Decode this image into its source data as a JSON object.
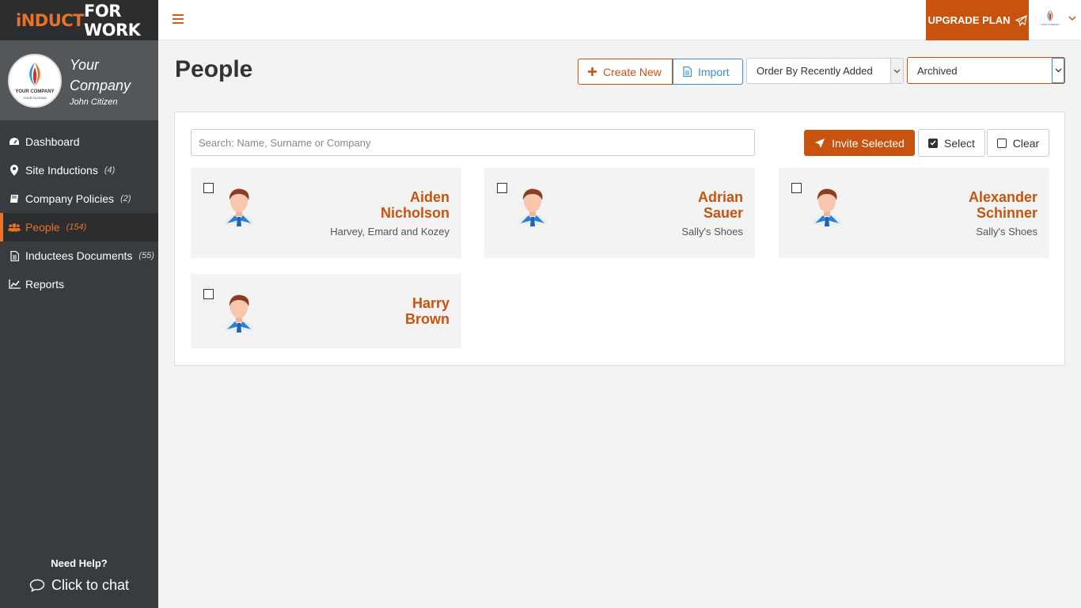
{
  "brand": {
    "part1": "iNDUCT",
    "part2": "FOR WORK"
  },
  "company": {
    "name_line1": "Your",
    "name_line2": "Company",
    "user": "John Citizen",
    "logo_text": "YOUR COMPANY",
    "logo_sub": "YOUR SLOGAN"
  },
  "nav": [
    {
      "label": "Dashboard",
      "count": "",
      "icon": "dashboard-icon"
    },
    {
      "label": "Site Inductions",
      "count": "(4)",
      "icon": "map-marker-icon"
    },
    {
      "label": "Company Policies",
      "count": "(2)",
      "icon": "book-icon"
    },
    {
      "label": "People",
      "count": "(154)",
      "icon": "users-icon"
    },
    {
      "label": "Inductees Documents",
      "count": "(55)",
      "icon": "document-icon"
    },
    {
      "label": "Reports",
      "count": "",
      "icon": "line-chart-icon"
    }
  ],
  "help": {
    "title": "Need Help?",
    "chat": "Click to chat"
  },
  "topbar": {
    "upgrade": "UPGRADE PLAN",
    "avatar_text": "YOUR COMPANY"
  },
  "header": {
    "title": "People",
    "create_new": "Create New",
    "import": "Import",
    "order_by": "Order By Recently Added",
    "filter": "Archived"
  },
  "toolbar": {
    "search_placeholder": "Search: Name, Surname or Company",
    "invite": "Invite Selected",
    "select": "Select",
    "clear": "Clear"
  },
  "people": [
    {
      "first": "Aiden",
      "last": "Nicholson",
      "company": "Harvey, Emard and Kozey"
    },
    {
      "first": "Adrian",
      "last": "Sauer",
      "company": "Sally's Shoes"
    },
    {
      "first": "Alexander",
      "last": "Schinner",
      "company": "Sally's Shoes"
    },
    {
      "first": "Harry",
      "last": "Brown",
      "company": ""
    }
  ],
  "colors": {
    "accent": "#c8530f",
    "brand_orange": "#e8722a",
    "sidebar": "#393c3e",
    "import_blue": "#3a8fd0"
  }
}
